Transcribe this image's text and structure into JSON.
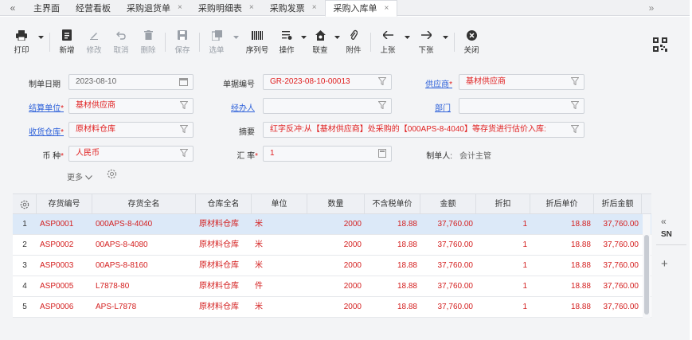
{
  "tabs": {
    "nav_left": "«",
    "nav_right": "»",
    "items": [
      {
        "label": "主界面",
        "closable": false,
        "active": false
      },
      {
        "label": "经营看板",
        "closable": false,
        "active": false
      },
      {
        "label": "采购退货单",
        "closable": true,
        "active": false
      },
      {
        "label": "采购明细表",
        "closable": true,
        "active": false
      },
      {
        "label": "采购发票",
        "closable": true,
        "active": false
      },
      {
        "label": "采购入库单",
        "closable": true,
        "active": true
      }
    ],
    "close_glyph": "×"
  },
  "toolbar": {
    "print": "打印",
    "new": "新增",
    "edit": "修改",
    "cancel": "取消",
    "delete": "删除",
    "save": "保存",
    "select": "选单",
    "serial": "序列号",
    "operate": "操作",
    "query": "联查",
    "attach": "附件",
    "prev": "上张",
    "next": "下张",
    "close": "关闭"
  },
  "form": {
    "date_label": "制单日期",
    "date_value": "2023-08-10",
    "docno_label": "单据编号",
    "docno_value": "GR-2023-08-10-00013",
    "supplier_label": "供应商",
    "supplier_value": "基材供应商",
    "settle_label": "结算单位",
    "settle_value": "基材供应商",
    "handler_label": "经办人",
    "handler_value": "",
    "dept_label": "部门",
    "dept_value": "",
    "warehouse_label": "收货仓库",
    "warehouse_value": "原材料仓库",
    "summary_label": "摘要",
    "summary_value": "红字反冲:从【基材供应商】处采购的【000APS-8-4040】等存货进行估价入库:",
    "currency_label": "币 种",
    "currency_value": "人民币",
    "rate_label": "汇 率",
    "rate_value": "1",
    "maker_label": "制单人:",
    "maker_value": "会计主管",
    "more": "更多"
  },
  "table": {
    "headers": [
      "存货编号",
      "存货全名",
      "仓库全名",
      "单位",
      "数量",
      "不含税单价",
      "金额",
      "折扣",
      "折后单价",
      "折后金额"
    ],
    "rows": [
      {
        "no": "1",
        "code": "ASP0001",
        "name": "000APS-8-4040",
        "wh": "原材料仓库",
        "unit": "米",
        "qty": "2000",
        "price": "18.88",
        "amount": "37,760.00",
        "disc": "1",
        "dprice": "18.88",
        "damount": "37,760.00"
      },
      {
        "no": "2",
        "code": "ASP0002",
        "name": "00APS-8-4080",
        "wh": "原材料仓库",
        "unit": "米",
        "qty": "2000",
        "price": "18.88",
        "amount": "37,760.00",
        "disc": "1",
        "dprice": "18.88",
        "damount": "37,760.00"
      },
      {
        "no": "3",
        "code": "ASP0003",
        "name": "00APS-8-8160",
        "wh": "原材料仓库",
        "unit": "米",
        "qty": "2000",
        "price": "18.88",
        "amount": "37,760.00",
        "disc": "1",
        "dprice": "18.88",
        "damount": "37,760.00"
      },
      {
        "no": "4",
        "code": "ASP0005",
        "name": "L7878-80",
        "wh": "原材料仓库",
        "unit": "件",
        "qty": "2000",
        "price": "18.88",
        "amount": "37,760.00",
        "disc": "1",
        "dprice": "18.88",
        "damount": "37,760.00"
      },
      {
        "no": "5",
        "code": "ASP0006",
        "name": "APS-L7878",
        "wh": "原材料仓库",
        "unit": "米",
        "qty": "2000",
        "price": "18.88",
        "amount": "37,760.00",
        "disc": "1",
        "dprice": "18.88",
        "damount": "37,760.00"
      }
    ]
  },
  "side": {
    "collapse": "«",
    "sn": "SN",
    "add": "+"
  },
  "colors": {
    "accent_red": "#d42020",
    "link_blue": "#2b5fd9",
    "selected_row": "#dce9f8"
  }
}
